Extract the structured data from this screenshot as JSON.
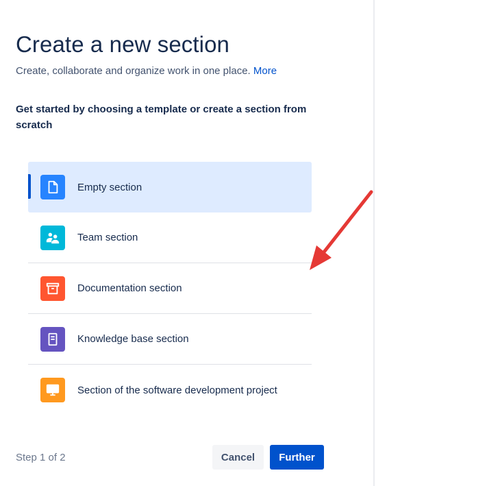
{
  "dialog": {
    "title": "Create a new section",
    "subtitle": "Create, collaborate and organize work in one place.",
    "more_link": "More",
    "prompt": "Get started by choosing a template or create a section from scratch"
  },
  "templates": [
    {
      "label": "Empty section",
      "icon": "document-icon",
      "color": "#2684ff",
      "selected": true
    },
    {
      "label": "Team section",
      "icon": "people-icon",
      "color": "#00b8d9",
      "selected": false
    },
    {
      "label": "Documentation section",
      "icon": "archive-icon",
      "color": "#ff5630",
      "selected": false
    },
    {
      "label": "Knowledge base section",
      "icon": "notebook-icon",
      "color": "#6554c0",
      "selected": false
    },
    {
      "label": "Section of the software development project",
      "icon": "monitor-icon",
      "color": "#ff991f",
      "selected": false
    }
  ],
  "footer": {
    "step": "Step 1 of 2",
    "cancel_label": "Cancel",
    "further_label": "Further"
  },
  "colors": {
    "accent": "#0052cc",
    "selected_bg": "#deebff",
    "annotation_arrow": "#e53935"
  }
}
